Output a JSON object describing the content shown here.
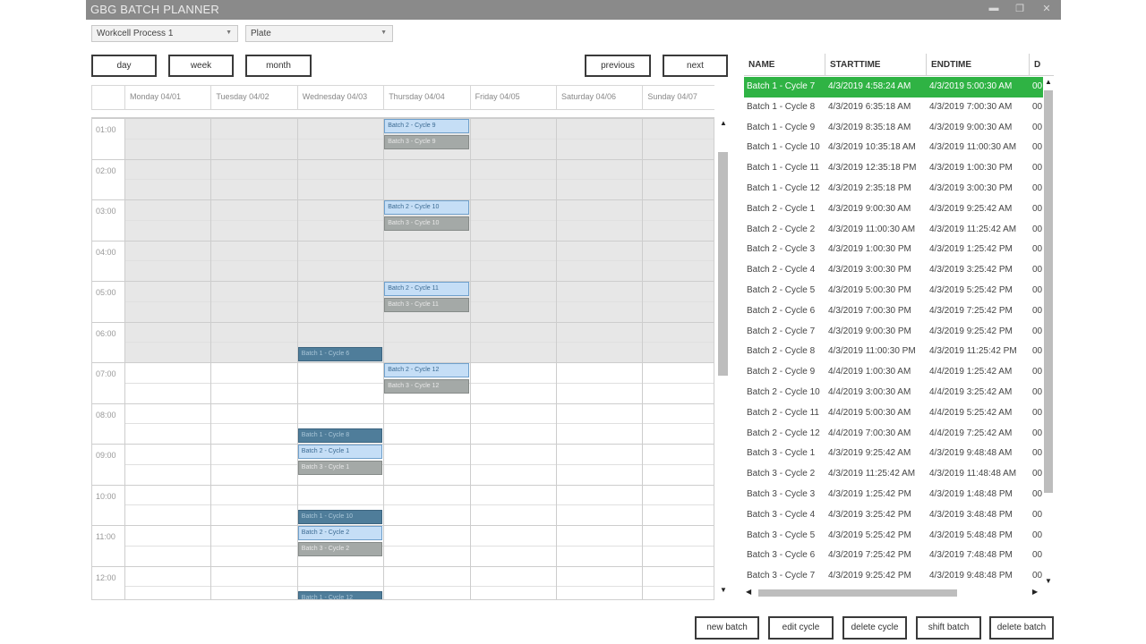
{
  "app": {
    "title": "GBG BATCH PLANNER",
    "minimize": "▬",
    "maximize": "❐",
    "close": "✕"
  },
  "filters": {
    "process": "Workcell Process 1",
    "material": "Plate"
  },
  "view_buttons": {
    "day": "day",
    "week": "week",
    "month": "month",
    "previous": "previous",
    "next": "next"
  },
  "days": [
    "Monday 04/01",
    "Tuesday 04/02",
    "Wednesday 04/03",
    "Thursday 04/04",
    "Friday 04/05",
    "Saturday 04/06",
    "Sunday 04/07"
  ],
  "hours": [
    "01:00",
    "02:00",
    "03:00",
    "04:00",
    "05:00",
    "06:00",
    "07:00",
    "08:00",
    "09:00",
    "10:00",
    "11:00",
    "12:00"
  ],
  "events": [
    {
      "day": 3,
      "start": 1.0,
      "label": "Batch 2 - Cycle 9",
      "kind": "b2"
    },
    {
      "day": 3,
      "start": 1.4,
      "label": "Batch 3 - Cycle 9",
      "kind": "b3"
    },
    {
      "day": 3,
      "start": 3.0,
      "label": "Batch 2 - Cycle 10",
      "kind": "b2"
    },
    {
      "day": 3,
      "start": 3.4,
      "label": "Batch 3 - Cycle 10",
      "kind": "b3"
    },
    {
      "day": 3,
      "start": 5.0,
      "label": "Batch 2 - Cycle 11",
      "kind": "b2"
    },
    {
      "day": 3,
      "start": 5.4,
      "label": "Batch 3 - Cycle 11",
      "kind": "b3"
    },
    {
      "day": 2,
      "start": 6.6,
      "label": "Batch 1 - Cycle 6",
      "kind": "b1"
    },
    {
      "day": 3,
      "start": 7.0,
      "label": "Batch 2 - Cycle 12",
      "kind": "b2"
    },
    {
      "day": 3,
      "start": 7.4,
      "label": "Batch 3 - Cycle 12",
      "kind": "b3"
    },
    {
      "day": 2,
      "start": 8.6,
      "label": "Batch 1 - Cycle 8",
      "kind": "b1"
    },
    {
      "day": 2,
      "start": 9.0,
      "label": "Batch 2 - Cycle 1",
      "kind": "b2"
    },
    {
      "day": 2,
      "start": 9.4,
      "label": "Batch 3 - Cycle 1",
      "kind": "b3"
    },
    {
      "day": 2,
      "start": 10.6,
      "label": "Batch 1 - Cycle 10",
      "kind": "b1"
    },
    {
      "day": 2,
      "start": 11.0,
      "label": "Batch 2 - Cycle 2",
      "kind": "b2"
    },
    {
      "day": 2,
      "start": 11.4,
      "label": "Batch 3 - Cycle 2",
      "kind": "b3"
    },
    {
      "day": 2,
      "start": 12.6,
      "label": "Batch 1 - Cycle 12",
      "kind": "b1"
    }
  ],
  "list": {
    "columns": [
      "NAME",
      "STARTTIME",
      "ENDTIME",
      "D"
    ],
    "rows": [
      [
        "Batch 1 - Cycle 7",
        "4/3/2019 4:58:24 AM",
        "4/3/2019 5:00:30 AM",
        "00"
      ],
      [
        "Batch 1 - Cycle 8",
        "4/3/2019 6:35:18 AM",
        "4/3/2019 7:00:30 AM",
        "00"
      ],
      [
        "Batch 1 - Cycle 9",
        "4/3/2019 8:35:18 AM",
        "4/3/2019 9:00:30 AM",
        "00"
      ],
      [
        "Batch 1 - Cycle 10",
        "4/3/2019 10:35:18 AM",
        "4/3/2019 11:00:30 AM",
        "00"
      ],
      [
        "Batch 1 - Cycle 11",
        "4/3/2019 12:35:18 PM",
        "4/3/2019 1:00:30 PM",
        "00"
      ],
      [
        "Batch 1 - Cycle 12",
        "4/3/2019 2:35:18 PM",
        "4/3/2019 3:00:30 PM",
        "00"
      ],
      [
        "Batch 2 - Cycle 1",
        "4/3/2019 9:00:30 AM",
        "4/3/2019 9:25:42 AM",
        "00"
      ],
      [
        "Batch 2 - Cycle 2",
        "4/3/2019 11:00:30 AM",
        "4/3/2019 11:25:42 AM",
        "00"
      ],
      [
        "Batch 2 - Cycle 3",
        "4/3/2019 1:00:30 PM",
        "4/3/2019 1:25:42 PM",
        "00"
      ],
      [
        "Batch 2 - Cycle 4",
        "4/3/2019 3:00:30 PM",
        "4/3/2019 3:25:42 PM",
        "00"
      ],
      [
        "Batch 2 - Cycle 5",
        "4/3/2019 5:00:30 PM",
        "4/3/2019 5:25:42 PM",
        "00"
      ],
      [
        "Batch 2 - Cycle 6",
        "4/3/2019 7:00:30 PM",
        "4/3/2019 7:25:42 PM",
        "00"
      ],
      [
        "Batch 2 - Cycle 7",
        "4/3/2019 9:00:30 PM",
        "4/3/2019 9:25:42 PM",
        "00"
      ],
      [
        "Batch 2 - Cycle 8",
        "4/3/2019 11:00:30 PM",
        "4/3/2019 11:25:42 PM",
        "00"
      ],
      [
        "Batch 2 - Cycle 9",
        "4/4/2019 1:00:30 AM",
        "4/4/2019 1:25:42 AM",
        "00"
      ],
      [
        "Batch 2 - Cycle 10",
        "4/4/2019 3:00:30 AM",
        "4/4/2019 3:25:42 AM",
        "00"
      ],
      [
        "Batch 2 - Cycle 11",
        "4/4/2019 5:00:30 AM",
        "4/4/2019 5:25:42 AM",
        "00"
      ],
      [
        "Batch 2 - Cycle 12",
        "4/4/2019 7:00:30 AM",
        "4/4/2019 7:25:42 AM",
        "00"
      ],
      [
        "Batch 3 - Cycle 1",
        "4/3/2019 9:25:42 AM",
        "4/3/2019 9:48:48 AM",
        "00"
      ],
      [
        "Batch 3 - Cycle 2",
        "4/3/2019 11:25:42 AM",
        "4/3/2019 11:48:48 AM",
        "00"
      ],
      [
        "Batch 3 - Cycle 3",
        "4/3/2019 1:25:42 PM",
        "4/3/2019 1:48:48 PM",
        "00"
      ],
      [
        "Batch 3 - Cycle 4",
        "4/3/2019 3:25:42 PM",
        "4/3/2019 3:48:48 PM",
        "00"
      ],
      [
        "Batch 3 - Cycle 5",
        "4/3/2019 5:25:42 PM",
        "4/3/2019 5:48:48 PM",
        "00"
      ],
      [
        "Batch 3 - Cycle 6",
        "4/3/2019 7:25:42 PM",
        "4/3/2019 7:48:48 PM",
        "00"
      ],
      [
        "Batch 3 - Cycle 7",
        "4/3/2019 9:25:42 PM",
        "4/3/2019 9:48:48 PM",
        "00"
      ]
    ],
    "selected_index": 0
  },
  "actions": {
    "new_batch": "new batch",
    "edit_cycle": "edit cycle",
    "delete_cycle": "delete cycle",
    "shift_batch": "shift batch",
    "delete_batch": "delete batch"
  },
  "colors": {
    "selected_row": "#2fb344",
    "batch1": "#4f7d9a",
    "batch2": "#c5def6",
    "batch3": "#a4a9a7"
  }
}
